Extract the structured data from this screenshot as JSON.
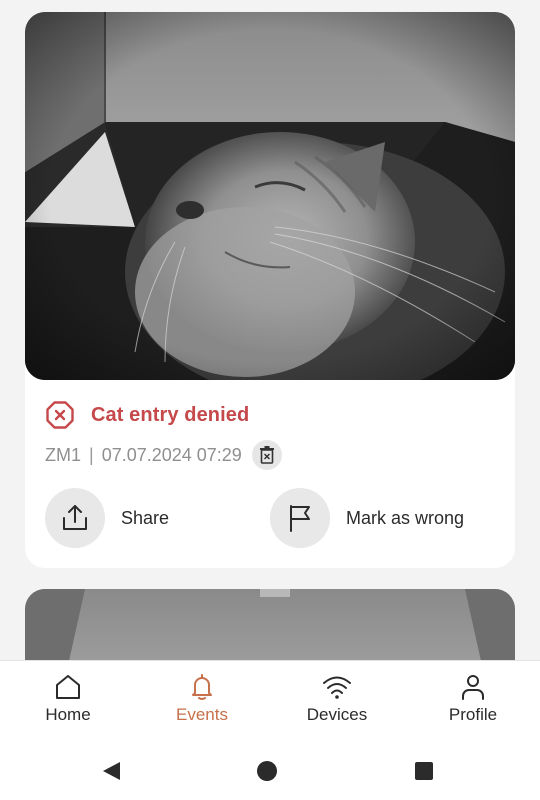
{
  "event": {
    "status": "Cat entry denied",
    "device": "ZM1",
    "separator": "|",
    "timestamp": "07.07.2024 07:29",
    "actions": {
      "share_label": "Share",
      "mark_wrong_label": "Mark as wrong"
    }
  },
  "nav": {
    "active": "Events",
    "items": [
      {
        "label": "Home",
        "icon": "home-icon"
      },
      {
        "label": "Events",
        "icon": "bell-icon"
      },
      {
        "label": "Devices",
        "icon": "wifi-icon"
      },
      {
        "label": "Profile",
        "icon": "person-icon"
      }
    ]
  },
  "colors": {
    "accent": "#c7714a",
    "denied": "#c5484b",
    "background": "#f3f3f3",
    "card": "#ffffff"
  }
}
